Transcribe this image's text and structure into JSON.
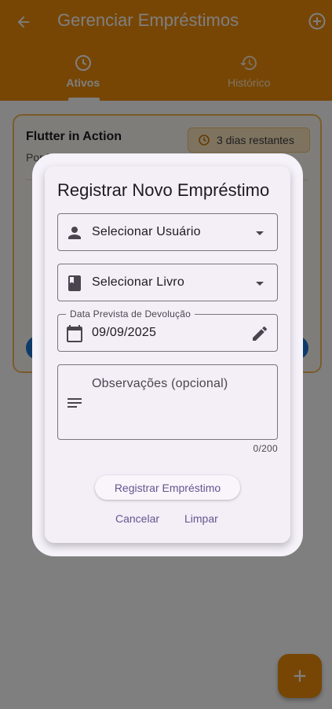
{
  "app_bar": {
    "title": "Gerenciar Empréstimos",
    "back_icon": "arrow-back-icon",
    "add_icon": "add-circle-outline-icon",
    "background_color": "#EE8C0A"
  },
  "tabs": [
    {
      "label": "Ativos",
      "icon": "clock-icon",
      "active": true
    },
    {
      "label": "Histórico",
      "icon": "history-icon",
      "active": false
    }
  ],
  "loan_card": {
    "book_title": "Flutter in Action",
    "author": "Por Eric Windmill",
    "days_remaining": "3 dias restantes",
    "chip_icon": "clock-icon"
  },
  "fab": {
    "icon": "add-icon"
  },
  "dialog": {
    "title": "Registrar Novo Empréstimo",
    "user_field": {
      "placeholder": "Selecionar Usuário",
      "icon": "person-icon",
      "trailing_icon": "dropdown-arrow-icon"
    },
    "book_field": {
      "placeholder": "Selecionar Livro",
      "icon": "book-icon",
      "trailing_icon": "dropdown-arrow-icon"
    },
    "date_field": {
      "label": "Data Prevista de Devolução",
      "value": "09/09/2025",
      "icon": "calendar-icon",
      "trailing_icon": "edit-pencil-icon"
    },
    "notes_field": {
      "placeholder": "Observações (opcional)",
      "icon": "notes-icon",
      "counter": "0/200"
    },
    "submit_label": "Registrar Empréstimo",
    "cancel_label": "Cancelar",
    "clear_label": "Limpar",
    "accent_color": "#65558F"
  }
}
